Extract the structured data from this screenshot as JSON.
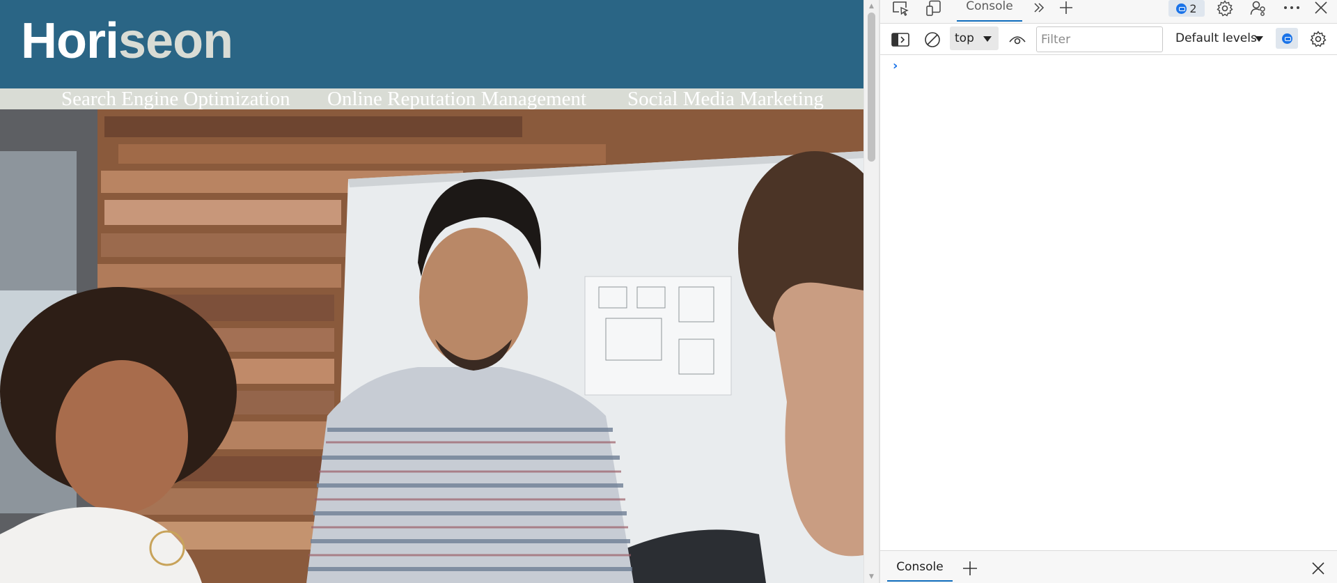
{
  "site": {
    "logo_part1": "Hori",
    "logo_part2": "seon",
    "nav": [
      "Search Engine Optimization",
      "Online Reputation Management",
      "Social Media Marketing"
    ],
    "colors": {
      "header": "#2a6585",
      "nav_bar": "#d9dcd5"
    },
    "hero_image": "photo of three people collaborating at a whiteboard in an office with wooden wall"
  },
  "devtools": {
    "tabbar": {
      "icons": [
        "inspect-element-icon",
        "device-emulation-icon",
        "more-tabs-icon",
        "add-tab-icon",
        "settings-icon",
        "connect-icon",
        "more-options-icon",
        "close-icon"
      ],
      "active_tab": "Console",
      "issues_count": "2"
    },
    "toolbar": {
      "context": "top",
      "filter_placeholder": "Filter",
      "levels": "Default levels"
    },
    "drawer": {
      "tab": "Console"
    },
    "colors": {
      "accent": "#0f6cbd",
      "issues_blue": "#1a73e8"
    }
  }
}
